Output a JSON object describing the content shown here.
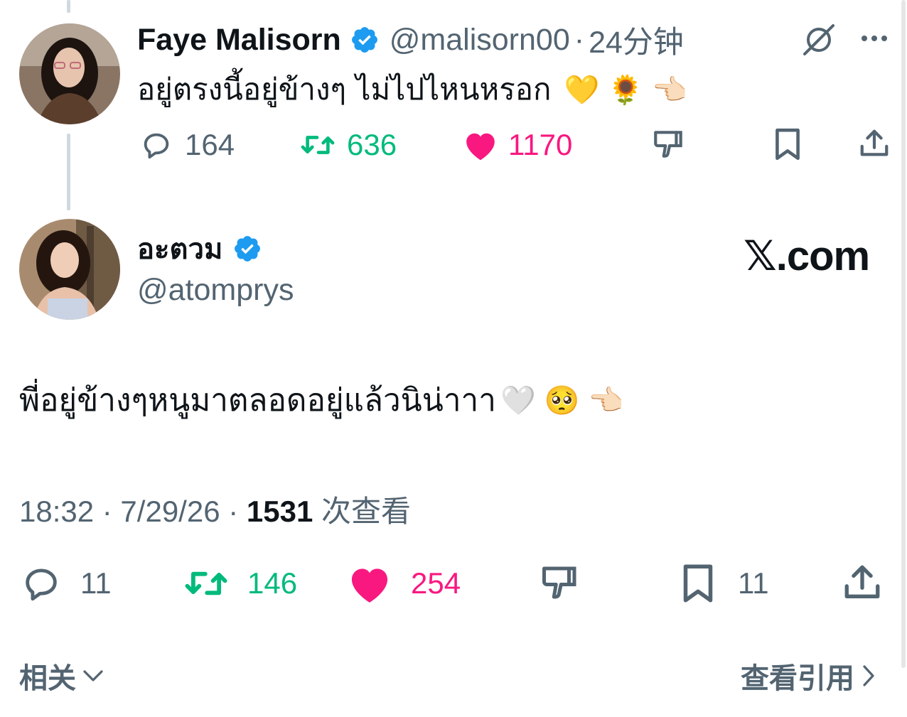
{
  "tweet1": {
    "name": "Faye Malisorn",
    "handle": "@malisorn00",
    "separator": "·",
    "time": "24分钟",
    "text": "อยู่ตรงนี้อยู่ข้างๆ ไม่ไปไหนหรอก",
    "emojis": [
      "💛",
      "🌻",
      "👈🏻"
    ],
    "stats": {
      "replies": "164",
      "retweets": "636",
      "likes": "1170"
    }
  },
  "tweet2": {
    "name": "อะตวม",
    "handle": "@atomprys",
    "text": "พี่อยู่ข้างๆหนูมาตลอดอยู่แล้วนิน่าาา",
    "emojis": [
      "🤍",
      "🥺",
      "👈🏻"
    ],
    "timestamp": "18:32 · 7/29/26 · ",
    "views_count": "1531",
    "views_label": " 次查看",
    "stats": {
      "replies": "11",
      "retweets": "146",
      "likes": "254",
      "bookmarks": "11"
    }
  },
  "watermark": "𝕏.com",
  "footer": {
    "related_label": "相关",
    "view_quotes_label": "查看引用"
  },
  "colors": {
    "verified": "#1d9bf0",
    "retweet": "#00ba7c",
    "like": "#f91880",
    "muted": "#536471"
  }
}
